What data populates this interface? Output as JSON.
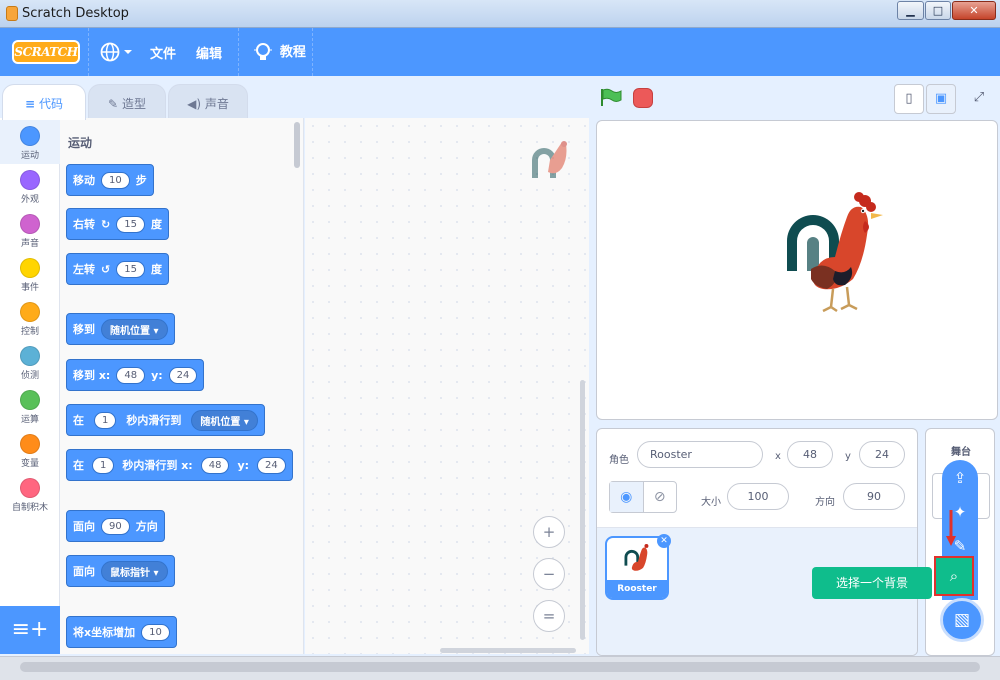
{
  "window": {
    "title": "Scratch Desktop",
    "min": "▁",
    "max": "□",
    "close": "✕"
  },
  "menu": {
    "logo": "SCRATCH",
    "file": "文件",
    "edit": "编辑",
    "tutorials": "教程"
  },
  "tabs": {
    "code": "代码",
    "costumes": "造型",
    "sounds": "声音"
  },
  "categories": [
    {
      "label": "运动",
      "color": "#4c97ff"
    },
    {
      "label": "外观",
      "color": "#9966ff"
    },
    {
      "label": "声音",
      "color": "#cf63cf"
    },
    {
      "label": "事件",
      "color": "#ffd500"
    },
    {
      "label": "控制",
      "color": "#ffab19"
    },
    {
      "label": "侦测",
      "color": "#5cb1d6"
    },
    {
      "label": "运算",
      "color": "#59c059"
    },
    {
      "label": "变量",
      "color": "#ff8c1a"
    },
    {
      "label": "自制积木",
      "color": "#ff6680"
    }
  ],
  "palette": {
    "heading": "运动",
    "move": {
      "a": "移动",
      "v": "10",
      "b": "步"
    },
    "turn_right": {
      "a": "右转",
      "v": "15",
      "b": "度"
    },
    "turn_left": {
      "a": "左转",
      "v": "15",
      "b": "度"
    },
    "goto": {
      "a": "移到",
      "d": "随机位置"
    },
    "goto_xy": {
      "a": "移到 x:",
      "x": "48",
      "yl": "y:",
      "y": "24"
    },
    "glide": {
      "a": "在",
      "v": "1",
      "b": "秒内滑行到",
      "d": "随机位置"
    },
    "glide_xy": {
      "a": "在",
      "v": "1",
      "b": "秒内滑行到 x:",
      "x": "48",
      "yl": "y:",
      "y": "24"
    },
    "point": {
      "a": "面向",
      "v": "90",
      "b": "方向"
    },
    "point_towards": {
      "a": "面向",
      "d": "鼠标指针"
    },
    "change_x": {
      "a": "将x坐标增加",
      "v": "10"
    }
  },
  "zoom": {
    "in": "+",
    "out": "−",
    "reset": "="
  },
  "sprite": {
    "label": "角色",
    "name": "Rooster",
    "x_label": "x",
    "x": "48",
    "y_label": "y",
    "y": "24",
    "show_label": "显示",
    "size_label": "大小",
    "size": "100",
    "dir_label": "方向",
    "direction": "90",
    "card_name": "Rooster"
  },
  "stage_panel": {
    "label": "舞台"
  },
  "tooltip": "选择一个背景",
  "accent": "#4c97ff",
  "green": "#0fbd8c"
}
